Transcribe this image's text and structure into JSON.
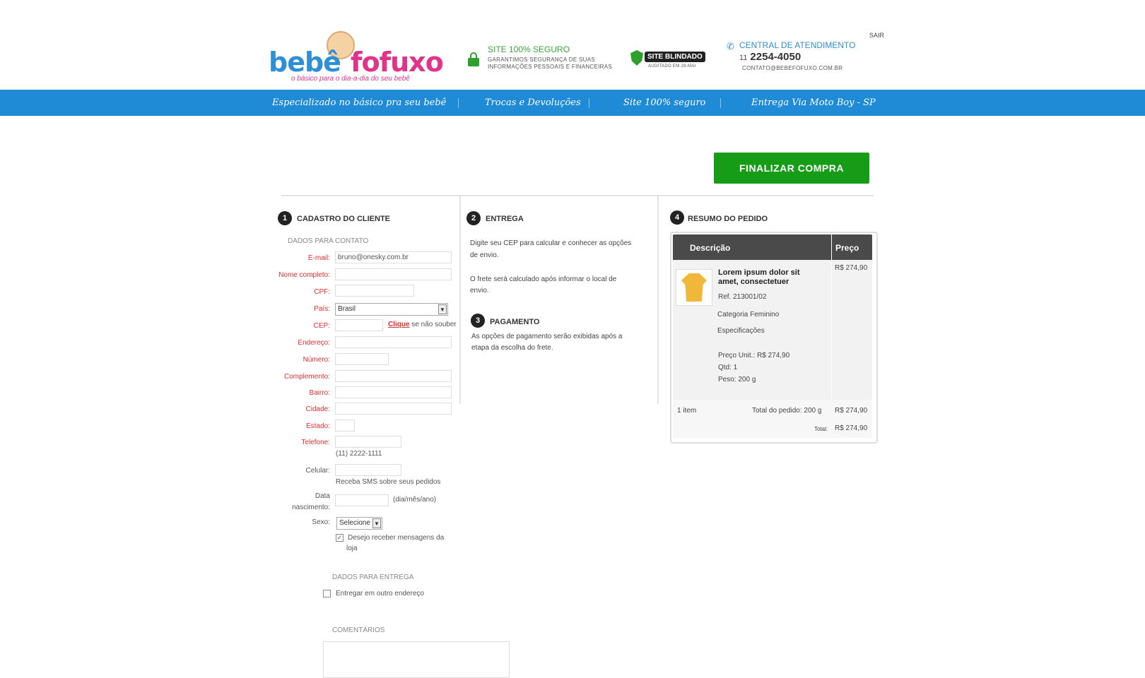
{
  "header": {
    "logo_bebe": "bebê",
    "logo_fofuxo": "fofuxo",
    "logo_tagline": "o básico para o dia-a-dia do seu bebê",
    "secure_title": "SITE 100% SEGURO",
    "secure_text_1": "GARANTIMOS SEGURANÇA DE SUAS",
    "secure_text_2": "INFORMAÇÕES PESSOAIS E FINANCEIRAS",
    "blindado_label": "SITE BLINDADO",
    "blindado_sub": "AUDITADO EM 28-MAI",
    "central_title": "CENTRAL DE ATENDIMENTO",
    "phone_ddd": "11",
    "phone_number": "2254-4050",
    "contact_email": "CONTATO@BEBEFOFUXO.COM.BR",
    "logout": "SAIR"
  },
  "nav": {
    "items": [
      "Especializado no básico pra seu bebê",
      "Trocas e Devoluções",
      "Site 100% seguro",
      "Entrega Via Moto Boy - SP"
    ]
  },
  "checkout": {
    "finalize_button": "FINALIZAR COMPRA"
  },
  "step1": {
    "number": "1",
    "title": "CADASTRO DO CLIENTE",
    "contact_heading": "DADOS PARA CONTATO",
    "labels": {
      "email": "E-mail:",
      "name": "Nome completo:",
      "cpf": "CPF:",
      "country": "País:",
      "cep": "CEP:",
      "address": "Endereço:",
      "number": "Número:",
      "complement": "Complemento:",
      "district": "Bairro:",
      "city": "Cidade:",
      "state": "Estado:",
      "phone": "Telefone:",
      "mobile": "Celular:",
      "birth_1": "Data",
      "birth_2": "nascimento:",
      "gender": "Sexo:"
    },
    "values": {
      "email": "bruno@onesky.com.br",
      "country": "Brasil",
      "gender": "Selecione"
    },
    "cep_link": "Clique",
    "cep_hint": "se não souber",
    "phone_hint": "(11) 2222-1111",
    "mobile_hint": "Receba SMS sobre seus pedidos",
    "birth_hint": "(dia/mês/ano)",
    "newsletter_1": "Desejo receber mensagens da",
    "newsletter_2": "loja",
    "delivery_heading": "DADOS PARA ENTREGA",
    "other_address": "Entregar em outro endereço",
    "comments_heading": "COMENTÁRIOS"
  },
  "step2": {
    "number": "2",
    "title": "ENTREGA",
    "text_1a": "Digite seu CEP para calcular e conhecer as opções",
    "text_1b": "de envio.",
    "text_2a": "O frete será calculado após informar o local de",
    "text_2b": "envio."
  },
  "step3": {
    "number": "3",
    "title": "PAGAMENTO",
    "text_a": "As opções de pagamento serão exibidas após a",
    "text_b": "etapa da escolha do frete."
  },
  "step4": {
    "number": "4",
    "title": "RESUMO DO PEDIDO",
    "col_desc": "Descrição",
    "col_price": "Preço",
    "product_name_1": "Lorem ipsum dolor sit",
    "product_name_2": "amet, consectetuer",
    "product_ref": "Ref. 213001/02",
    "product_category": "Categoria Feminino",
    "product_specs": "Especificações",
    "unit_price": "Preço Unit.: R$ 274,90",
    "qty": "Qtd: 1",
    "weight": "Peso: 200 g",
    "product_price": "R$ 274,90",
    "items_count": "1 item",
    "total_weight": "Total do pedido: 200 g",
    "subtotal": "R$ 274,90",
    "total_label": "Total:",
    "total": "R$ 274,90"
  }
}
